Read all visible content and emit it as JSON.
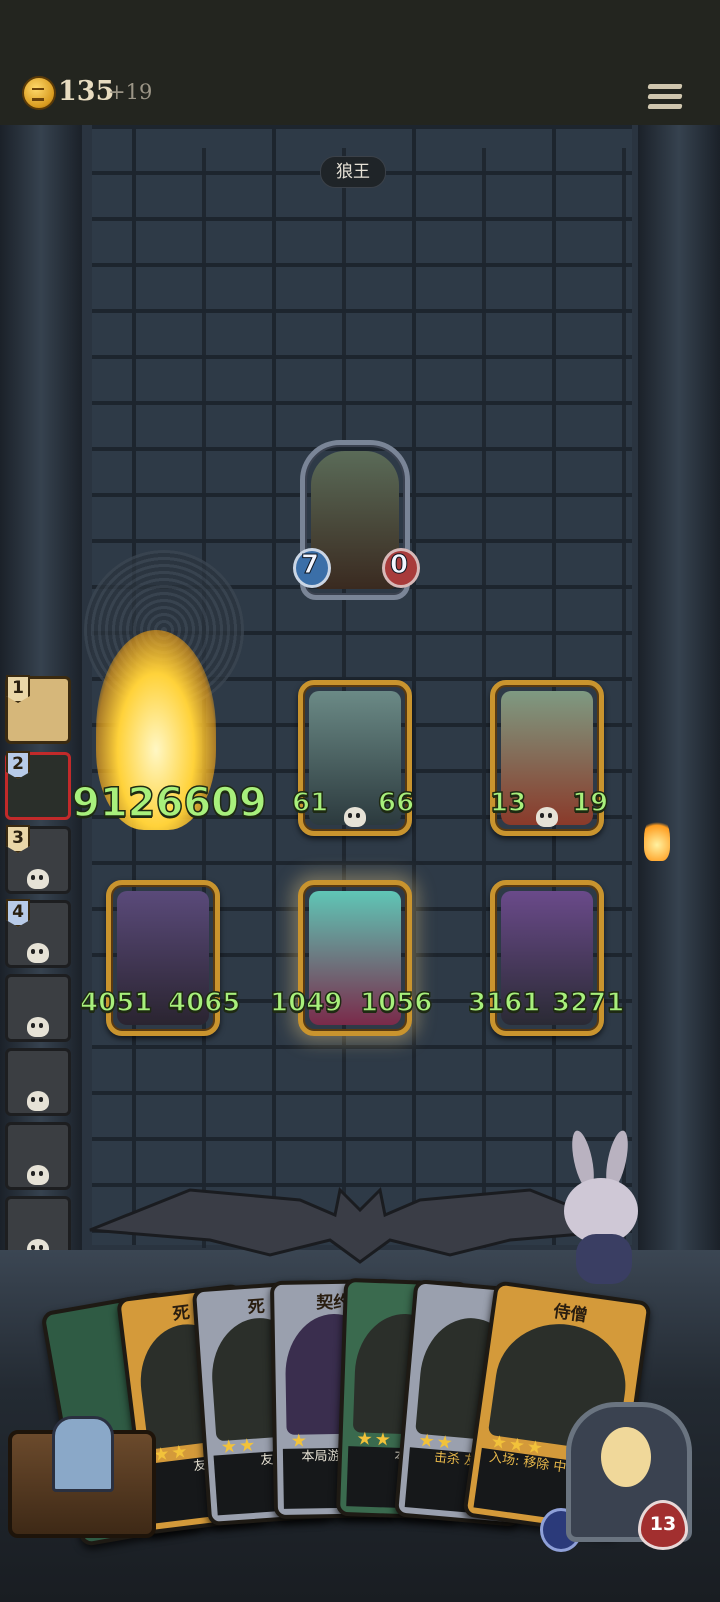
{
  "header": {
    "gold": "135",
    "gold_bonus": "+19",
    "menu_icon": "menu-icon"
  },
  "boss": {
    "name": "狼王",
    "attack": "7",
    "health": "0"
  },
  "board": {
    "top_row": [
      {
        "attack": "61",
        "health": "66"
      },
      {
        "attack": "13",
        "health": "19"
      }
    ],
    "damage_popup": "9126609",
    "bottom_row": [
      {
        "attack": "4051",
        "health": "4065"
      },
      {
        "attack": "1049",
        "health": "1056"
      },
      {
        "attack": "3161",
        "health": "3271"
      }
    ]
  },
  "side_queue": [
    {
      "num": "1",
      "state": "active"
    },
    {
      "num": "2",
      "state": "selected"
    },
    {
      "num": "3",
      "state": "dead"
    },
    {
      "num": "4",
      "state": "dead"
    },
    {
      "num": "",
      "state": "dead"
    },
    {
      "num": "",
      "state": "dead"
    },
    {
      "num": "",
      "state": "dead"
    },
    {
      "num": "",
      "state": "dead"
    }
  ],
  "hand": [
    {
      "title": "死",
      "text": "友"
    },
    {
      "title": "死",
      "text": "友"
    },
    {
      "title": "契约",
      "text": "本局游 击杀"
    },
    {
      "title": "",
      "text": "本"
    },
    {
      "title": "",
      "text": "击杀 友方"
    },
    {
      "title": "侍僧",
      "text": "入场: 移除 中的随从,"
    }
  ],
  "player": {
    "hp": "13"
  },
  "colors": {
    "stat_green": "#a8f07c",
    "gold_frame": "#c9942e",
    "shield_blue": "#3b6fa8",
    "heart_red": "#a83b3b"
  }
}
